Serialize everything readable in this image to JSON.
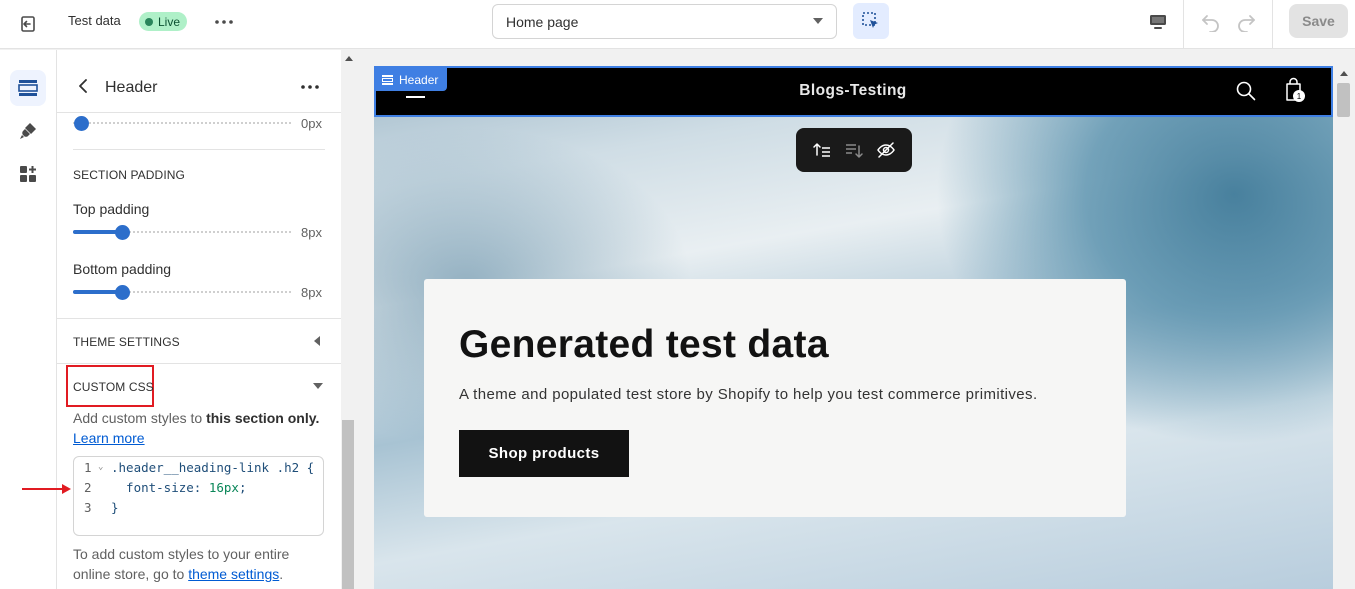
{
  "topbar": {
    "theme_name": "Test data",
    "live_label": "Live",
    "page_select_value": "Home page",
    "save_label": "Save"
  },
  "panel": {
    "title": "Header",
    "first_slider_value": "0px",
    "section_padding_label": "SECTION PADDING",
    "top_padding_label": "Top padding",
    "top_padding_value": "8px",
    "top_padding_level": 8,
    "bottom_padding_label": "Bottom padding",
    "bottom_padding_value": "8px",
    "bottom_padding_level": 8,
    "theme_settings_label": "THEME SETTINGS",
    "custom_css_label": "CUSTOM CSS",
    "custom_css_help_prefix": "Add custom styles to ",
    "custom_css_help_bold": "this section only.",
    "learn_more": "Learn more",
    "code_lines": [
      {
        "n": "1",
        "text": ".header__heading-link .h2 {"
      },
      {
        "n": "2",
        "text": "  font-size: ",
        "num": "16px",
        "suffix": ";"
      },
      {
        "n": "3",
        "text": "}"
      }
    ],
    "footer_help_prefix": "To add custom styles to your entire online store, go to ",
    "footer_help_link": "theme settings",
    "footer_help_suffix": "."
  },
  "preview": {
    "header_tag": "Header",
    "store_title": "Blogs-Testing",
    "cart_count": "1",
    "hero_title": "Generated test data",
    "hero_text": "A theme and populated test store by Shopify to help you test commerce primitives.",
    "hero_button": "Shop products"
  },
  "colors": {
    "accent": "#2c6ecb",
    "selection_blue": "#3f7fe3",
    "live_badge_bg": "#aff0c8",
    "annotation_red": "#e11b22"
  }
}
